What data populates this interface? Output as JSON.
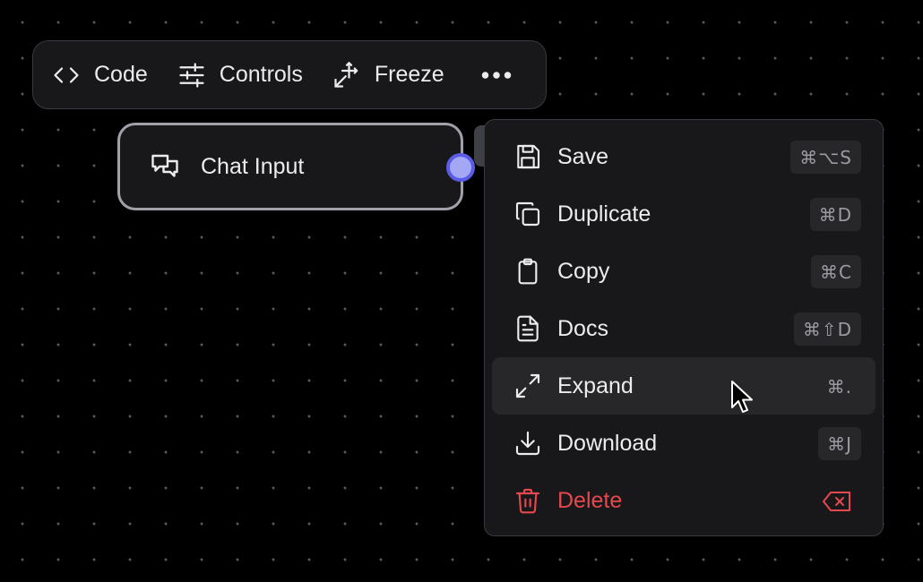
{
  "toolbar": {
    "code": {
      "label": "Code",
      "icon": "code-icon"
    },
    "controls": {
      "label": "Controls",
      "icon": "sliders-icon"
    },
    "freeze": {
      "label": "Freeze",
      "icon": "freeze-icon"
    },
    "more": {
      "icon": "more-horizontal-icon"
    }
  },
  "node": {
    "title": "Chat Input",
    "icon": "chat-messages-icon"
  },
  "menu": {
    "items": [
      {
        "label": "Save",
        "shortcut": "⌘⌥S",
        "icon": "save-icon"
      },
      {
        "label": "Duplicate",
        "shortcut": "⌘D",
        "icon": "duplicate-icon"
      },
      {
        "label": "Copy",
        "shortcut": "⌘C",
        "icon": "clipboard-icon"
      },
      {
        "label": "Docs",
        "shortcut": "⌘⇧D",
        "icon": "file-text-icon"
      },
      {
        "label": "Expand",
        "shortcut": "⌘.",
        "icon": "maximize-icon"
      },
      {
        "label": "Download",
        "shortcut": "⌘J",
        "icon": "download-icon"
      },
      {
        "label": "Delete",
        "icon": "trash-icon",
        "shortcut_icon": "delete-key-icon"
      }
    ]
  },
  "colors": {
    "accent": "#5b5ce6",
    "danger": "#e5484d",
    "surface": "#18181b",
    "hover": "#27272a"
  }
}
